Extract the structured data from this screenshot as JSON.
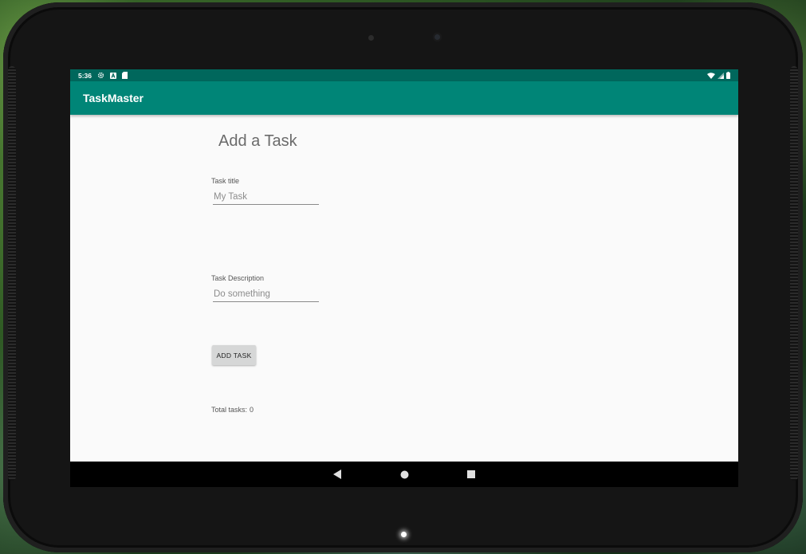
{
  "status_bar": {
    "time": "5:36",
    "left_icons": [
      "gear-icon",
      "a-badge-icon",
      "sd-card-icon"
    ],
    "right_icons": [
      "wifi-icon",
      "signal-icon",
      "battery-icon"
    ]
  },
  "app_bar": {
    "title": "TaskMaster"
  },
  "form": {
    "heading": "Add a Task",
    "title_label": "Task title",
    "title_placeholder": "My Task",
    "description_label": "Task Description",
    "description_placeholder": "Do something",
    "submit_label": "ADD TASK"
  },
  "summary": {
    "total_label": "Total tasks:",
    "total_count": "0"
  },
  "nav_bar": {
    "buttons": [
      "back-icon",
      "home-icon",
      "recents-icon"
    ]
  },
  "colors": {
    "status_bar": "#00675c",
    "app_bar": "#008577",
    "screen_bg": "#fafafa"
  }
}
